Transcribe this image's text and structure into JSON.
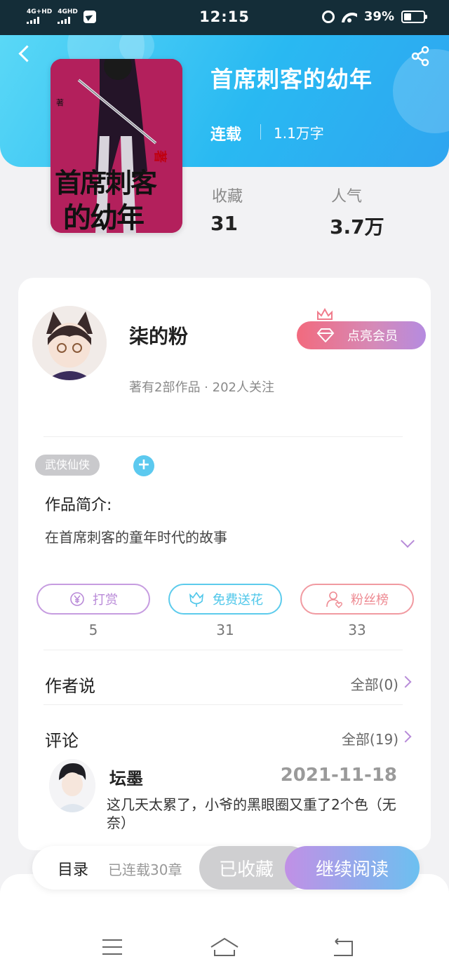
{
  "status_bar": {
    "net1": "4G+HD",
    "net2": "4GHD",
    "time": "12:15",
    "battery": "39%",
    "battery_level": 0.39
  },
  "book": {
    "title": "首席刺客的幼年",
    "status": "连载",
    "words": "1.1万字",
    "cover_title_line1": "首席刺客",
    "cover_title_line2": "的幼年",
    "cover_small": "著"
  },
  "stats": [
    {
      "label": "收藏",
      "value": "31"
    },
    {
      "label": "人气",
      "value": "3.7万"
    }
  ],
  "author": {
    "name": "柒的粉",
    "meta": "著有2部作品 · 202人关注",
    "vip_label": "点亮会员"
  },
  "tags": [
    "武侠仙侠"
  ],
  "tag_add": "+",
  "intro": {
    "title": "作品简介:",
    "text": "在首席刺客的童年时代的故事"
  },
  "actions": [
    {
      "label": "打赏",
      "count": "5",
      "color": "#b98ad8",
      "icon": "yen-icon"
    },
    {
      "label": "免费送花",
      "count": "31",
      "color": "#4fc7ea",
      "icon": "flower-icon"
    },
    {
      "label": "粉丝榜",
      "count": "33",
      "color": "#ee8a92",
      "icon": "fan-user-icon"
    }
  ],
  "author_says": {
    "title": "作者说",
    "more": "全部(0)"
  },
  "comments": {
    "title": "评论",
    "more": "全部(19)",
    "items": [
      {
        "user": "坛墨",
        "date": "2021-11-18",
        "text": "这几天太累了，小爷的黑眼圈又重了2个色（无奈）"
      }
    ]
  },
  "bottom_bar": {
    "toc": "目录",
    "chapters": "已连载30章",
    "favorited": "已收藏",
    "continue": "继续阅读"
  },
  "colors": {
    "header_start": "#5ad8f6",
    "header_end": "#2fa5f0",
    "accent_purple": "#b78bd8",
    "accent_blue": "#4fc7ea",
    "accent_pink": "#ee8a92"
  }
}
